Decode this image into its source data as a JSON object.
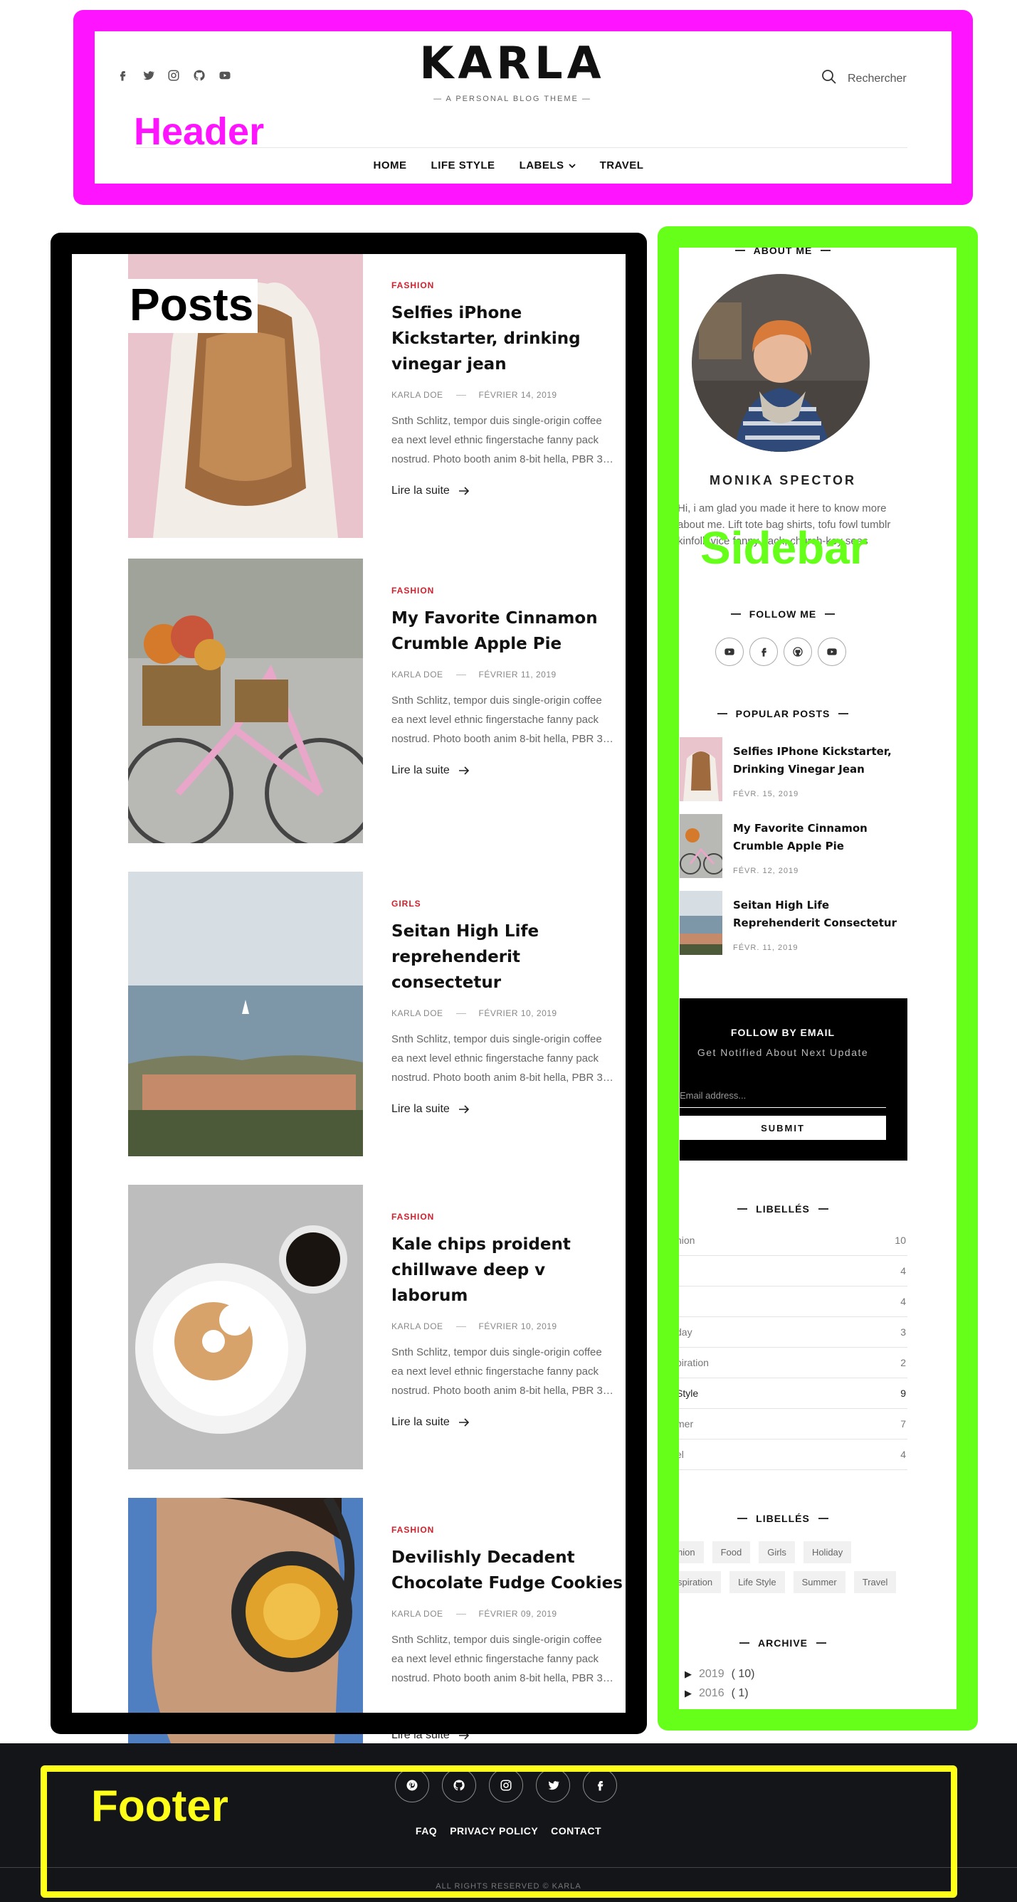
{
  "colors": {
    "header_box": "#ff14ff",
    "posts_box": "#000000",
    "sidebar_box": "#66ff1a",
    "footer_box": "#ffff1a",
    "category_red": "#d4202c",
    "footer_bg": "#141518"
  },
  "annotations": {
    "header": "Header",
    "posts": "Posts",
    "sidebar": "Sidebar",
    "footer": "Footer"
  },
  "header": {
    "social_icons": [
      "facebook-icon",
      "twitter-icon",
      "instagram-icon",
      "github-icon",
      "youtube-icon"
    ],
    "logo": "KARLA",
    "tagline": "— A PERSONAL BLOG THEME —",
    "search_label": "Rechercher",
    "nav": [
      "HOME",
      "LIFE STYLE",
      "LABELS",
      "TRAVEL"
    ]
  },
  "posts": [
    {
      "category": "FASHION",
      "title": "Selfies iPhone Kickstarter, drinking vinegar jean",
      "author": "KARLA DOE",
      "date": "FÉVRIER 14, 2019",
      "excerpt": [
        "Snth Schlitz, tempor duis single-origin coffee",
        "ea next level ethnic fingerstache fanny pack",
        "nostrud. Photo booth anim 8-bit hella, PBR 3…"
      ],
      "read_more": "Lire la suite"
    },
    {
      "category": "FASHION",
      "title": "My Favorite Cinnamon Crumble Apple Pie",
      "author": "KARLA DOE",
      "date": "FÉVRIER 11, 2019",
      "excerpt": [
        "Snth Schlitz, tempor duis single-origin coffee",
        "ea next level ethnic fingerstache fanny pack",
        "nostrud. Photo booth anim 8-bit hella, PBR 3…"
      ],
      "read_more": "Lire la suite"
    },
    {
      "category": "GIRLS",
      "title": "Seitan High Life reprehenderit consectetur",
      "author": "KARLA DOE",
      "date": "FÉVRIER 10, 2019",
      "excerpt": [
        "Snth Schlitz, tempor duis single-origin coffee",
        "ea next level ethnic fingerstache fanny pack",
        "nostrud. Photo booth anim 8-bit hella, PBR 3…"
      ],
      "read_more": "Lire la suite"
    },
    {
      "category": "FASHION",
      "title": "Kale chips proident chillwave deep v laborum",
      "author": "KARLA DOE",
      "date": "FÉVRIER 10, 2019",
      "excerpt": [
        "Snth Schlitz, tempor duis single-origin coffee",
        "ea next level ethnic fingerstache fanny pack",
        "nostrud. Photo booth anim 8-bit hella, PBR 3…"
      ],
      "read_more": "Lire la suite"
    },
    {
      "category": "FASHION",
      "title": "Devilishly Decadent Chocolate Fudge Cookies",
      "author": "KARLA DOE",
      "date": "FÉVRIER 09, 2019",
      "excerpt": [
        "Snth Schlitz, tempor duis single-origin coffee",
        "ea next level ethnic fingerstache fanny pack",
        "nostrud. Photo booth anim 8-bit hella, PBR 3…"
      ],
      "read_more": "Lire la suite"
    }
  ],
  "sidebar": {
    "about_title": "ABOUT ME",
    "author_name": "MONIKA SPECTOR",
    "bio": "Hi, i am glad you made it here to know more about me. Lift tote bag shirts, tofu fowl tumblr kinfolk vice fanny pack, church-key seas",
    "follow_title": "FOLLOW ME",
    "follow_icons": [
      "youtube-icon",
      "facebook-icon",
      "github-icon",
      "youtube-icon"
    ],
    "popular_title": "POPULAR POSTS",
    "popular": [
      {
        "title": "Selfies IPhone Kickstarter, Drinking Vinegar Jean",
        "date": "FÉVR. 15, 2019"
      },
      {
        "title": "My Favorite Cinnamon Crumble Apple Pie",
        "date": "FÉVR. 12, 2019"
      },
      {
        "title": "Seitan High Life Reprehenderit Consectetur",
        "date": "FÉVR. 11, 2019"
      }
    ],
    "email": {
      "title": "FOLLOW BY EMAIL",
      "subtitle": "Get Notified About Next Update",
      "placeholder": "Email address...",
      "submit": "SUBMIT"
    },
    "labels_title": "LIBELLÉS",
    "labels": [
      {
        "name": "hion",
        "count": "10"
      },
      {
        "name": "",
        "count": "4"
      },
      {
        "name": "",
        "count": "4"
      },
      {
        "name": "day",
        "count": "3"
      },
      {
        "name": "piration",
        "count": "2"
      },
      {
        "name": "Style",
        "count": "9"
      },
      {
        "name": "mer",
        "count": "7"
      },
      {
        "name": "el",
        "count": "4"
      }
    ],
    "tags_title": "LIBELLÉS",
    "tags": [
      "hion",
      "Food",
      "Girls",
      "Holiday",
      "spiration",
      "Life Style",
      "Summer",
      "Travel"
    ],
    "archive_title": "ARCHIVE",
    "archive": [
      {
        "year": "2019",
        "count": "( 10)"
      },
      {
        "year": "2016",
        "count": "( 1)"
      }
    ]
  },
  "footer": {
    "icons": [
      "pinterest-icon",
      "github-icon",
      "instagram-icon",
      "twitter-icon",
      "facebook-icon"
    ],
    "links": [
      "FAQ",
      "PRIVACY POLICY",
      "CONTACT"
    ],
    "copyright": "ALL RIGHTS RESERVED © KARLA"
  }
}
